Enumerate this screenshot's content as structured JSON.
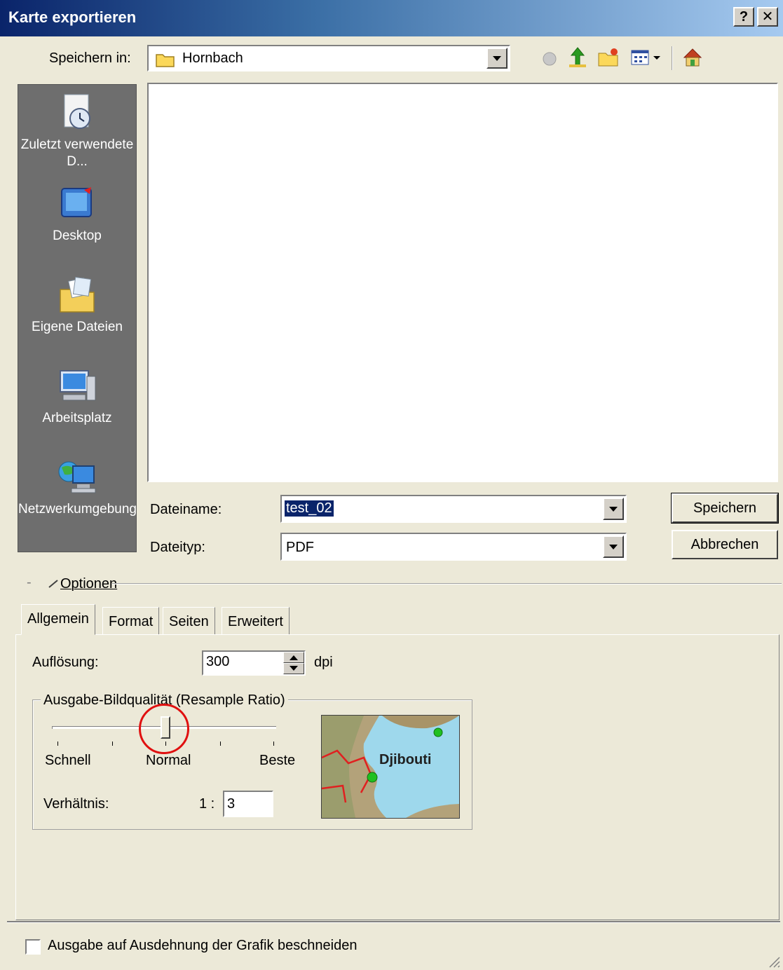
{
  "window": {
    "title": "Karte exportieren",
    "help_btn": "?",
    "close_btn": "✕"
  },
  "toolbar": {
    "look_in_label": "Speichern in:",
    "look_in_value": "Hornbach"
  },
  "places": [
    {
      "label": "Zuletzt verwendete D...",
      "icon": "recent-documents-icon"
    },
    {
      "label": "Desktop",
      "icon": "desktop-icon"
    },
    {
      "label": "Eigene Dateien",
      "icon": "my-documents-icon"
    },
    {
      "label": "Arbeitsplatz",
      "icon": "my-computer-icon"
    },
    {
      "label": "Netzwerkumgebung",
      "icon": "network-icon"
    }
  ],
  "file": {
    "name_label": "Dateiname:",
    "name_value": "test_02",
    "type_label": "Dateityp:",
    "type_value": "PDF"
  },
  "buttons": {
    "save": "Speichern",
    "cancel": "Abbrechen"
  },
  "options": {
    "header": "Optionen",
    "tabs": [
      "Allgemein",
      "Format",
      "Seiten",
      "Erweitert"
    ],
    "active_tab": "Allgemein",
    "resolution_label": "Auflösung:",
    "resolution_value": "300",
    "resolution_unit": "dpi",
    "quality_group": "Ausgabe-Bildqualität (Resample Ratio)",
    "slider_labels": {
      "fast": "Schnell",
      "normal": "Normal",
      "best": "Beste"
    },
    "slider_position": 0.5,
    "ratio_label": "Verhältnis:",
    "ratio_prefix": "1 :",
    "ratio_value": "3",
    "preview_label": "Djibouti"
  },
  "checkbox_clip": {
    "label": "Ausgabe auf Ausdehnung der Grafik beschneiden",
    "checked": false
  },
  "colors": {
    "title_bar": "#0a246a",
    "places_bg": "#6e6e6e",
    "highlight": "#0a246a",
    "annotation": "#e01010"
  }
}
